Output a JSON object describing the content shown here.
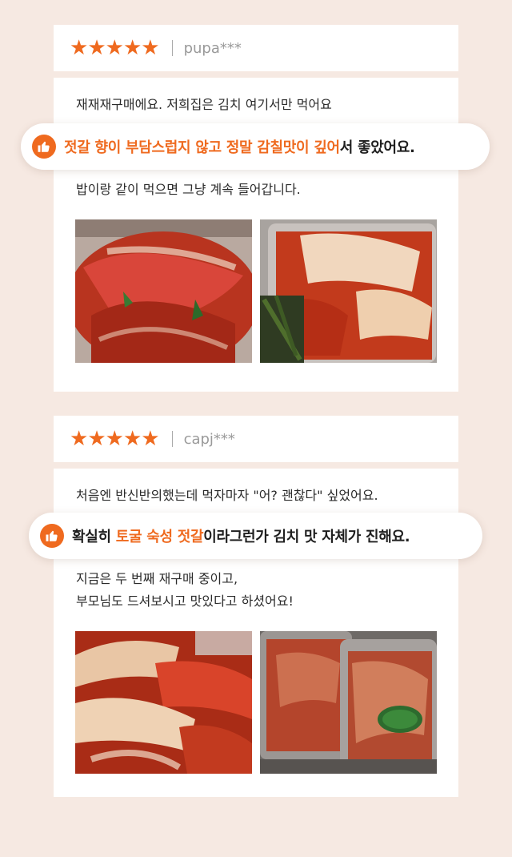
{
  "reviews": [
    {
      "stars": [
        "★",
        "★",
        "★",
        "★",
        "★"
      ],
      "user": "pupa***",
      "line1": "재재재구매에요. 저희집은 김치 여기서만 먹어요",
      "highlight_orange": "젓갈 향이 부담스럽지 않고 정말 감칠맛이 깊어",
      "highlight_rest": "서 좋았어요.",
      "line3": "밥이랑 같이 먹으면 그냥 계속 들어갑니다."
    },
    {
      "stars": [
        "★",
        "★",
        "★",
        "★",
        "★"
      ],
      "user": "capj***",
      "line1": "처음엔 반신반의했는데 먹자마자 \"어? 괜찮다\" 싶었어요.",
      "highlight_pre": "확실히 ",
      "highlight_orange": "토굴 숙성 젓갈",
      "highlight_rest": "이라그런가 김치 맛 자체가 진해요.",
      "line3": "지금은 두 번째 재구매 중이고,",
      "line4": "부모님도 드셔보시고 맛있다고 하셨어요!"
    }
  ],
  "colors": {
    "accent": "#ef6a1f",
    "background": "#f6e9e2"
  },
  "icons": {
    "highlight": "thumbs-up-icon"
  }
}
